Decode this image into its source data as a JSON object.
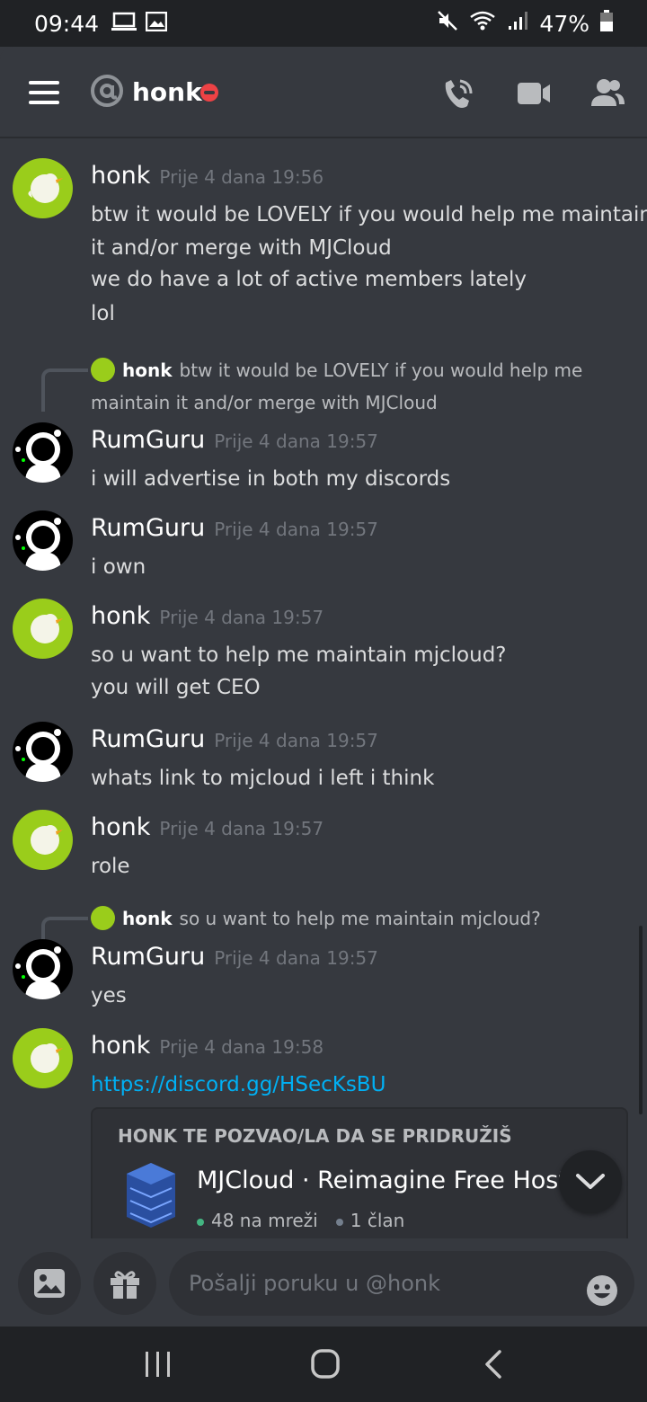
{
  "status_bar": {
    "time": "09:44",
    "battery": "47%"
  },
  "header": {
    "title": "honk"
  },
  "messages": [
    {
      "author": "honk",
      "timestamp": "Prije 4 dana 19:56",
      "lines": [
        "btw it would be LOVELY if you would help me maintain",
        "it and/or merge with MJCloud",
        "we do have a lot of active members lately",
        "lol"
      ]
    },
    {
      "reply": {
        "author": "honk",
        "text_line1": "btw it would be LOVELY if you would help me",
        "text_line2": "maintain it and/or merge with MJCloud"
      },
      "author": "RumGuru",
      "timestamp": "Prije 4 dana 19:57",
      "lines": [
        "i will advertise in both my discords"
      ]
    },
    {
      "author": "RumGuru",
      "timestamp": "Prije 4 dana 19:57",
      "lines": [
        "i own"
      ]
    },
    {
      "author": "honk",
      "timestamp": "Prije 4 dana 19:57",
      "lines": [
        "so u want to help me maintain mjcloud?",
        "you will get CEO"
      ]
    },
    {
      "author": "RumGuru",
      "timestamp": "Prije 4 dana 19:57",
      "lines": [
        "whats link to mjcloud i left i think"
      ]
    },
    {
      "author": "honk",
      "timestamp": "Prije 4 dana 19:57",
      "lines": [
        "role"
      ]
    },
    {
      "reply": {
        "author": "honk",
        "text_line1": "so u want to help me maintain mjcloud?"
      },
      "author": "RumGuru",
      "timestamp": "Prije 4 dana 19:57",
      "lines": [
        "yes"
      ]
    },
    {
      "author": "honk",
      "timestamp": "Prije 4 dana 19:58",
      "lines": [
        "https://discord.gg/HSecKsBU"
      ]
    }
  ],
  "invite": {
    "title": "HONK TE POZVAO/LA DA SE PRIDRUŽIŠ",
    "server_name": "MJCloud · Reimagine Free Host",
    "online": "48 na mreži",
    "members": "1 član"
  },
  "composer": {
    "placeholder": "Pošalji poruku u @honk"
  },
  "colors": {
    "background": "#36393f",
    "link": "#00b0f4",
    "dnd": "#ed4245",
    "honk_avatar": "#9acd1b"
  }
}
